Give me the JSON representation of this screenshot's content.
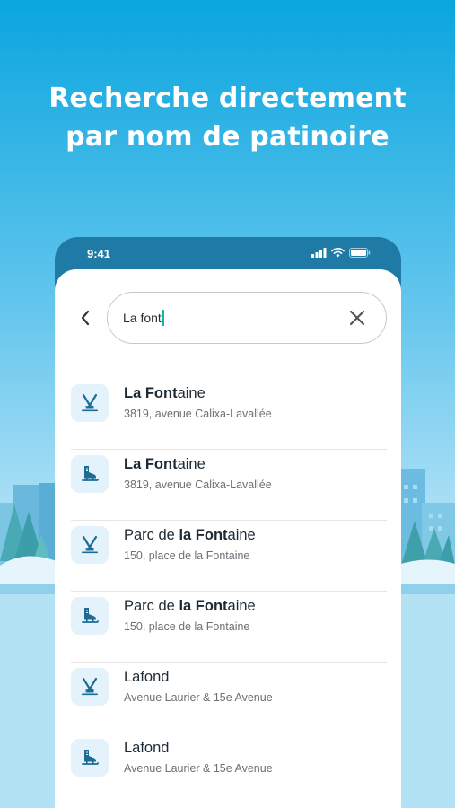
{
  "headline": {
    "line1": "Recherche directement",
    "line2": "par nom de patinoire"
  },
  "status_bar": {
    "time": "9:41"
  },
  "search": {
    "value": "La font"
  },
  "results": [
    {
      "icon": "hockey-sticks-icon",
      "title_pre": "",
      "title_bold": "La Font",
      "title_post": "aine",
      "address": "3819, avenue Calixa-Lavallée"
    },
    {
      "icon": "skate-icon",
      "title_pre": "",
      "title_bold": "La Font",
      "title_post": "aine",
      "address": "3819, avenue Calixa-Lavallée"
    },
    {
      "icon": "hockey-sticks-icon",
      "title_pre": "Parc de ",
      "title_bold": "la Font",
      "title_post": "aine",
      "address": "150, place de la Fontaine"
    },
    {
      "icon": "skate-icon",
      "title_pre": "Parc de ",
      "title_bold": "la Font",
      "title_post": "aine",
      "address": "150, place de la Fontaine"
    },
    {
      "icon": "hockey-sticks-icon",
      "title_pre": "Lafond",
      "title_bold": "",
      "title_post": "",
      "address": "Avenue Laurier & 15e Avenue"
    },
    {
      "icon": "skate-icon",
      "title_pre": "Lafond",
      "title_bold": "",
      "title_post": "",
      "address": "Avenue Laurier & 15e Avenue"
    }
  ],
  "colors": {
    "accent": "#1f7ba6",
    "icon": "#1d6c93",
    "badge_bg": "#e4f3fb",
    "caret": "#1bb3a0"
  }
}
